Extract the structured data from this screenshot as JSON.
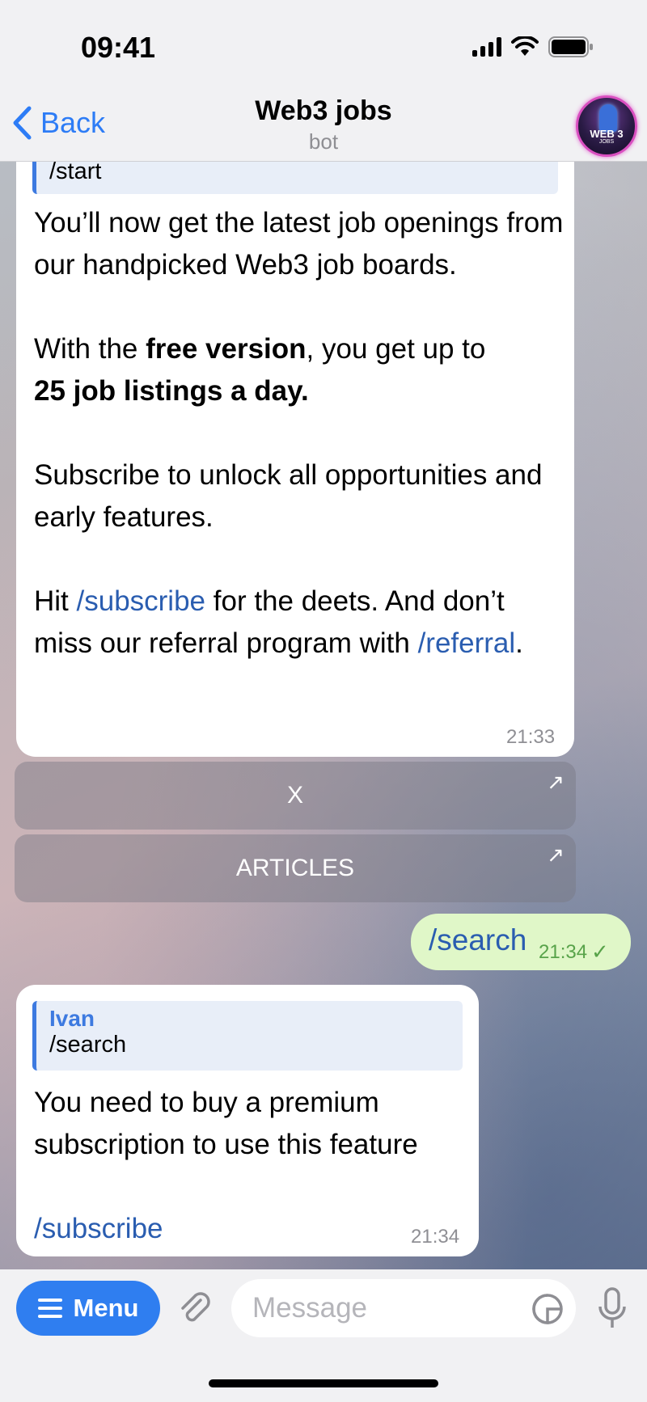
{
  "status_bar": {
    "time": "09:41"
  },
  "nav": {
    "back_label": "Back",
    "title": "Web3 jobs",
    "subtitle": "bot",
    "avatar_text": "WEB 3",
    "avatar_sub": "JOBS"
  },
  "messages": {
    "first": {
      "reply_text": "/start",
      "p1": "You’ll now get the latest job openings from our handpicked Web3 job boards.",
      "p2_a": "With the ",
      "p2_bold1": "free version",
      "p2_b": ", you get up to ",
      "p2_bold2": "25 job listings a day.",
      "p3": "Subscribe to unlock all opportunities and early features.",
      "p4_a": "Hit ",
      "p4_cmd1": "/subscribe",
      "p4_b": " for the deets. And don’t miss our referral program with ",
      "p4_cmd2": "/referral",
      "p4_c": ".",
      "time": "21:33"
    },
    "buttons": [
      {
        "label": "X",
        "arrow": "↗"
      },
      {
        "label": "ARTICLES",
        "arrow": "↗"
      }
    ],
    "outgoing": {
      "text": "/search",
      "time": "21:34",
      "check": "✓"
    },
    "second": {
      "reply_author": "Ivan",
      "reply_text": "/search",
      "p1": "You need to buy a premium subscription to use this feature",
      "cmd": "/subscribe",
      "time": "21:34"
    }
  },
  "input_bar": {
    "menu_label": "Menu",
    "placeholder": "Message"
  },
  "colors": {
    "accent": "#2f7ef0",
    "link": "#2a5db0",
    "outgoing_bubble": "#e0f7c8"
  }
}
